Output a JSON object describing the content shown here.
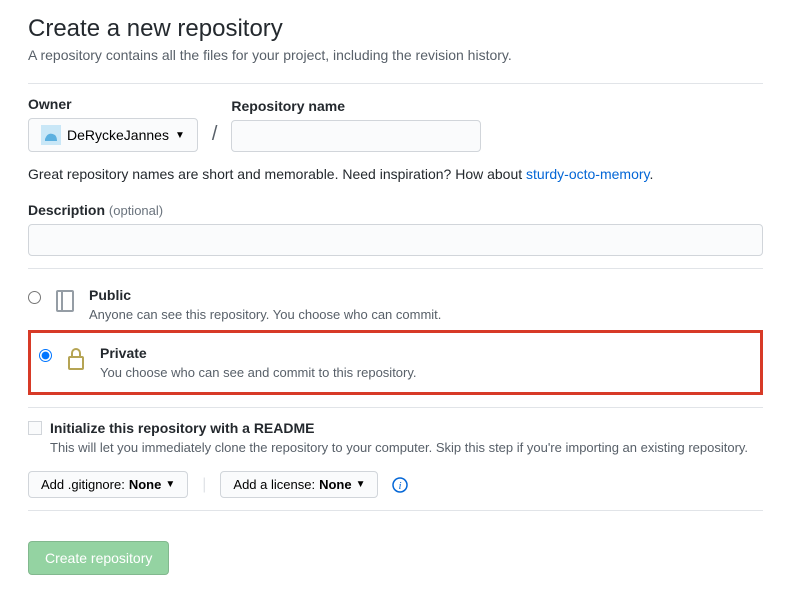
{
  "title": "Create a new repository",
  "subtitle": "A repository contains all the files for your project, including the revision history.",
  "owner": {
    "label": "Owner",
    "value": "DeRyckeJannes"
  },
  "repo": {
    "label": "Repository name",
    "value": ""
  },
  "tip": {
    "text": "Great repository names are short and memorable. Need inspiration? How about ",
    "suggestion": "sturdy-octo-memory",
    "suffix": "."
  },
  "description": {
    "label": "Description",
    "optional": "(optional)",
    "value": ""
  },
  "visibility": {
    "public": {
      "title": "Public",
      "desc": "Anyone can see this repository. You choose who can commit."
    },
    "private": {
      "title": "Private",
      "desc": "You choose who can see and commit to this repository."
    },
    "selected": "private"
  },
  "initReadme": {
    "label": "Initialize this repository with a README",
    "desc": "This will let you immediately clone the repository to your computer. Skip this step if you're importing an existing repository."
  },
  "gitignore": {
    "prefix": "Add .gitignore: ",
    "value": "None"
  },
  "license": {
    "prefix": "Add a license: ",
    "value": "None"
  },
  "submit": "Create repository"
}
